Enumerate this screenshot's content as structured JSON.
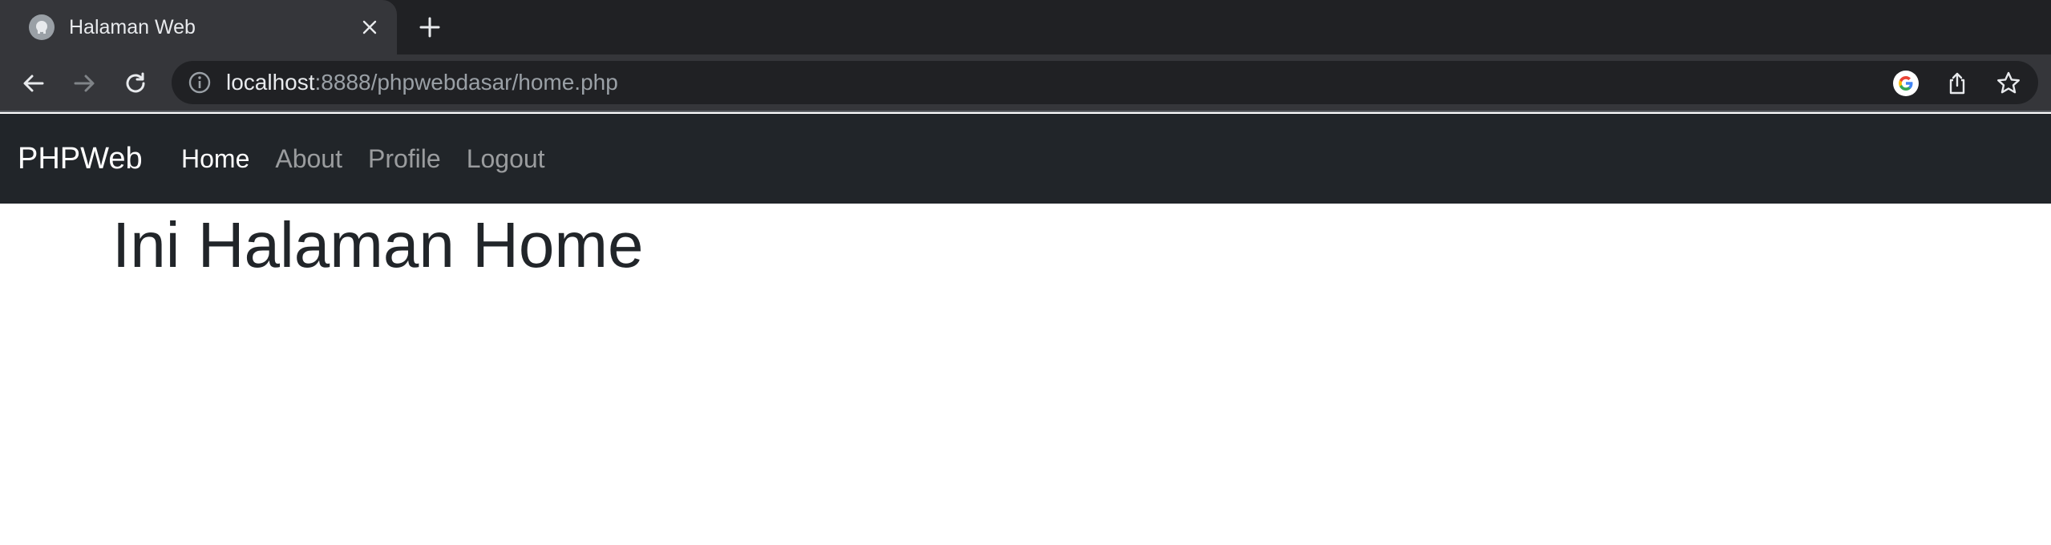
{
  "browser": {
    "tab": {
      "title": "Halaman Web"
    },
    "address_bar": {
      "host": "localhost",
      "path": ":8888/phpwebdasar/home.php"
    }
  },
  "page": {
    "navbar": {
      "brand": "PHPWeb",
      "links": [
        {
          "label": "Home",
          "active": true
        },
        {
          "label": "About",
          "active": false
        },
        {
          "label": "Profile",
          "active": false
        },
        {
          "label": "Logout",
          "active": false
        }
      ]
    },
    "heading": "Ini Halaman Home"
  },
  "colors": {
    "tabstrip_bg": "#202124",
    "toolbar_bg": "#35363a",
    "navbar_bg": "#212529",
    "heading_text": "#212529"
  },
  "icons": [
    "favicon-icon",
    "close-icon",
    "plus-icon",
    "back-arrow-icon",
    "forward-arrow-icon",
    "reload-icon",
    "info-icon",
    "google-icon",
    "share-icon",
    "star-icon"
  ]
}
